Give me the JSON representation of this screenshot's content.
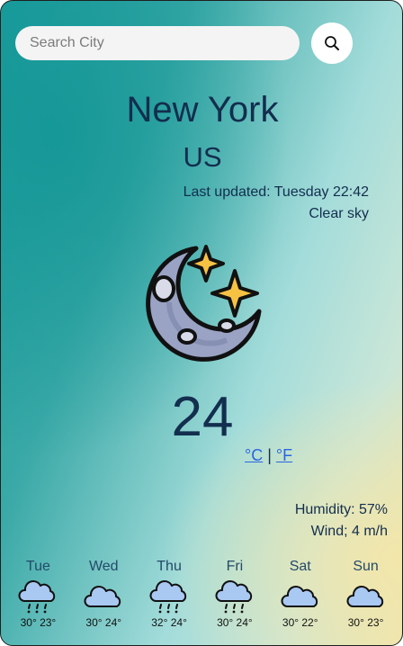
{
  "search": {
    "placeholder": "Search City",
    "value": ""
  },
  "location": {
    "city": "New York",
    "country": "US"
  },
  "status": {
    "updated": "Last updated: Tuesday 22:42",
    "description": "Clear sky"
  },
  "current": {
    "icon": "moon-stars-icon",
    "temperature": "24"
  },
  "units": {
    "celsius": "°C",
    "separator": "|",
    "fahrenheit": "°F"
  },
  "details": {
    "humidity": "Humidity: 57%",
    "wind": "Wind; 4 m/h"
  },
  "forecast": [
    {
      "day": "Tue",
      "icon": "rain-cloud-icon",
      "temps": "30° 23°"
    },
    {
      "day": "Wed",
      "icon": "cloud-icon",
      "temps": "30° 24°"
    },
    {
      "day": "Thu",
      "icon": "rain-cloud-icon",
      "temps": "32° 24°"
    },
    {
      "day": "Fri",
      "icon": "rain-cloud-icon",
      "temps": "30° 24°"
    },
    {
      "day": "Sat",
      "icon": "cloud-icon",
      "temps": "30° 22°"
    },
    {
      "day": "Sun",
      "icon": "cloud-icon",
      "temps": "30° 23°"
    }
  ],
  "colors": {
    "text": "#132e4e",
    "link": "#2966e0",
    "moon": "#9aa3c4",
    "star": "#f6c244",
    "cloud": "#a9c8f2"
  }
}
